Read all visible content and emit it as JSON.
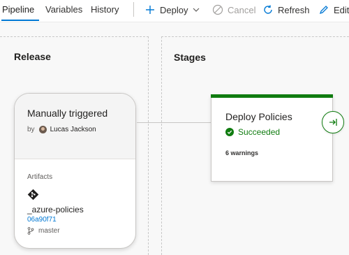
{
  "tabs": [
    {
      "label": "Pipeline",
      "active": true
    },
    {
      "label": "Variables",
      "active": false
    },
    {
      "label": "History",
      "active": false
    }
  ],
  "toolbar": {
    "deploy_label": "Deploy",
    "cancel_label": "Cancel",
    "refresh_label": "Refresh",
    "edit_label": "Edit"
  },
  "release": {
    "title": "Release",
    "trigger": "Manually triggered",
    "by_prefix": "by",
    "user": "Lucas Jackson",
    "artifacts_label": "Artifacts",
    "artifact_name": "_azure-policies",
    "commit": "06a90f71",
    "branch": "master"
  },
  "stages": {
    "title": "Stages",
    "items": [
      {
        "name": "Deploy Policies",
        "status": "Succeeded",
        "warnings": "6 warnings"
      }
    ]
  },
  "colors": {
    "accent": "#0078d4",
    "success": "#107c10"
  },
  "icons": [
    "plus-icon",
    "chevron-down-icon",
    "cancel-icon",
    "refresh-icon",
    "edit-icon",
    "git-icon",
    "branch-icon",
    "check-circle-icon",
    "deploy-arrow-icon"
  ]
}
